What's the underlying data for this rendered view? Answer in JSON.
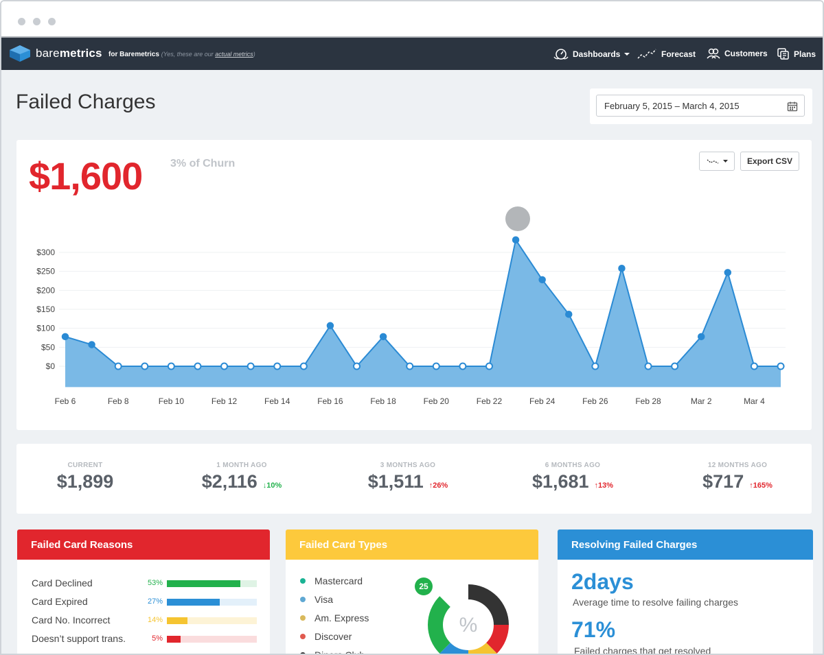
{
  "nav": {
    "brand_light": "bare",
    "brand_bold": "metrics",
    "brand_for": "for Baremetrics",
    "brand_note": "(Yes, these are our ",
    "brand_note_link": "actual metrics",
    "brand_note_end": ")",
    "items": [
      {
        "label": "Dashboards",
        "icon": "dashboard-icon",
        "dropdown": true
      },
      {
        "label": "Forecast",
        "icon": "forecast-icon"
      },
      {
        "label": "Customers",
        "icon": "customers-icon"
      },
      {
        "label": "Plans",
        "icon": "plans-icon"
      }
    ]
  },
  "page": {
    "title": "Failed Charges",
    "date_range": "February  5, 2015 – March  4, 2015",
    "big_value": "$1,600",
    "churn_note": "3% of Churn",
    "export_label": "Export CSV"
  },
  "chart_data": {
    "type": "area",
    "x": [
      "Feb 6",
      "Feb 7",
      "Feb 8",
      "Feb 9",
      "Feb 10",
      "Feb 11",
      "Feb 12",
      "Feb 13",
      "Feb 14",
      "Feb 15",
      "Feb 16",
      "Feb 17",
      "Feb 18",
      "Feb 19",
      "Feb 20",
      "Feb 21",
      "Feb 22",
      "Feb 23",
      "Feb 24",
      "Feb 25",
      "Feb 26",
      "Feb 27",
      "Feb 28",
      "Mar 1",
      "Mar 2",
      "Mar 3",
      "Mar 4",
      "Mar 5"
    ],
    "values": [
      78,
      57,
      0,
      0,
      0,
      0,
      0,
      0,
      0,
      0,
      107,
      0,
      78,
      0,
      0,
      0,
      0,
      333,
      228,
      137,
      0,
      258,
      0,
      0,
      78,
      247,
      0,
      0
    ],
    "x_tick_labels": [
      "Feb 6",
      "Feb 8",
      "Feb 10",
      "Feb 12",
      "Feb 14",
      "Feb 16",
      "Feb 18",
      "Feb 20",
      "Feb 22",
      "Feb 24",
      "Feb 26",
      "Feb 28",
      "Mar 2",
      "Mar 4"
    ],
    "y_tick_labels": [
      "$0",
      "$50",
      "$100",
      "$150",
      "$200",
      "$250",
      "$300"
    ],
    "y_ticks": [
      0,
      50,
      100,
      150,
      200,
      250,
      300
    ],
    "ylim": [
      -55,
      340
    ],
    "grid": true,
    "colors": {
      "fill": "#7ab9e6",
      "line": "#2a8ad4",
      "point": "#2a8ad4"
    }
  },
  "stats": [
    {
      "label": "CURRENT",
      "value": "$1,899",
      "change": "",
      "direction": ""
    },
    {
      "label": "1 MONTH AGO",
      "value": "$2,116",
      "change": "10%",
      "direction": "down"
    },
    {
      "label": "3 MONTHS AGO",
      "value": "$1,511",
      "change": "26%",
      "direction": "up"
    },
    {
      "label": "6 MONTHS AGO",
      "value": "$1,681",
      "change": "13%",
      "direction": "up"
    },
    {
      "label": "12 MONTHS AGO",
      "value": "$717",
      "change": "165%",
      "direction": "up"
    }
  ],
  "reasons": {
    "title": "Failed Card Reasons",
    "items": [
      {
        "label": "Card Declined",
        "pct": "53%",
        "value": 0.82,
        "color": "#22b14c",
        "track": "#dff3e5"
      },
      {
        "label": "Card Expired",
        "pct": "27%",
        "value": 0.59,
        "color": "#2b8fd6",
        "track": "#e3f0fa"
      },
      {
        "label": "Card No. Incorrect",
        "pct": "14%",
        "value": 0.23,
        "color": "#f5c431",
        "track": "#fdf3d6"
      },
      {
        "label": "Doesn’t support trans.",
        "pct": "5%",
        "value": 0.15,
        "color": "#e1262d",
        "track": "#fadcdd"
      }
    ]
  },
  "types": {
    "title": "Failed Card Types",
    "badge": "25",
    "center": "%",
    "items": [
      {
        "label": "Mastercard",
        "color": "#1ab394"
      },
      {
        "label": "Visa",
        "color": "#5fa8d3"
      },
      {
        "label": "Am. Express",
        "color": "#d9b95c"
      },
      {
        "label": "Discover",
        "color": "#e05a4f"
      },
      {
        "label": "Diners Club",
        "color": "#333333"
      }
    ],
    "donut": [
      {
        "share": 0.25,
        "color": "#333333"
      },
      {
        "share": 0.125,
        "color": "#e1262d"
      },
      {
        "share": 0.125,
        "color": "#f5c431"
      },
      {
        "share": 0.125,
        "color": "#2b8fd6"
      },
      {
        "share": 0.25,
        "color": "#22b14c"
      }
    ]
  },
  "resolving": {
    "title": "Resolving Failed Charges",
    "days": "2days",
    "days_text": "Average time to resolve failing charges",
    "pct": "71%",
    "pct_text": "Failed charges that get resolved"
  },
  "colors": {
    "red": "#e1262d",
    "yellow": "#fdc93c",
    "blue": "#2b8fd6",
    "nav": "#2b3440",
    "green": "#22b14c"
  }
}
